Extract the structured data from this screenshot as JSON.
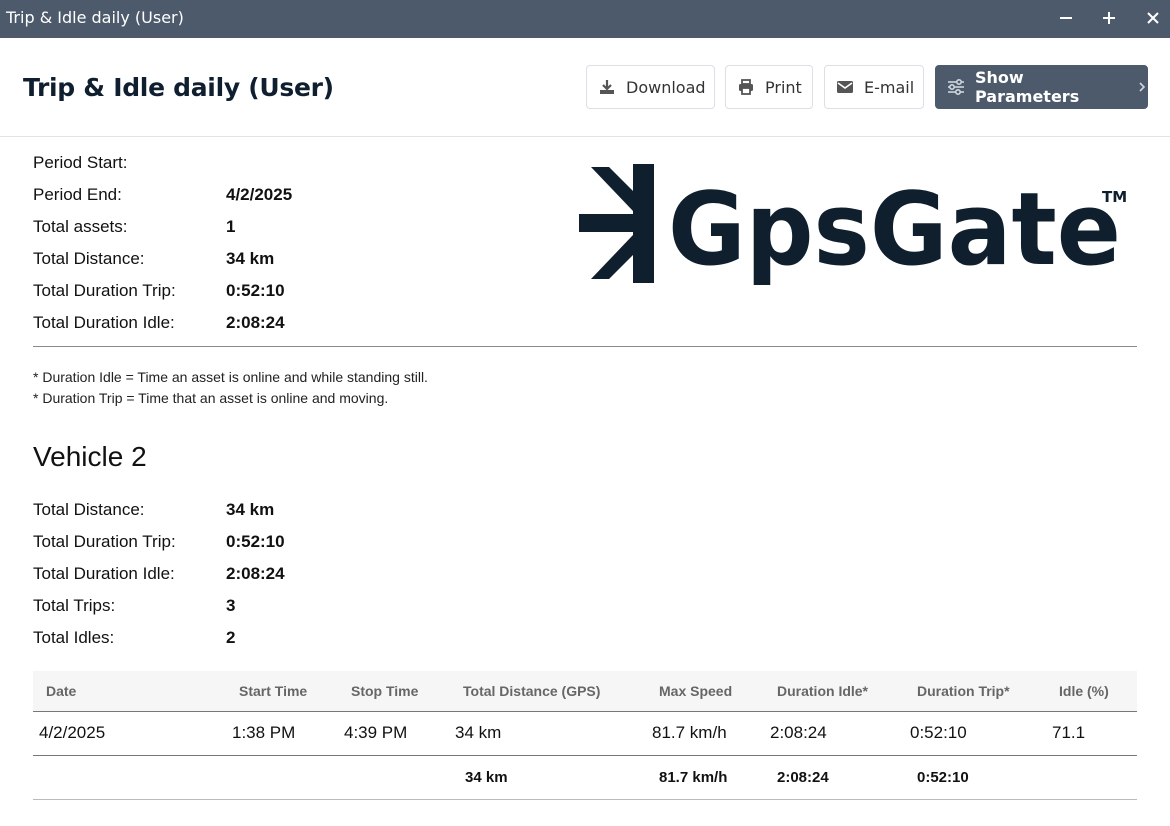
{
  "window": {
    "title": "Trip & Idle daily (User)",
    "controls": [
      "minimize",
      "maximize",
      "close"
    ]
  },
  "header": {
    "title": "Trip & Idle daily (User)",
    "buttons": {
      "download": "Download",
      "print": "Print",
      "email": "E-mail",
      "show_parameters": "Show Parameters"
    }
  },
  "colors": {
    "titlebar": "#4d5a6b",
    "primary_button": "#4d5a6b",
    "logo": "#0f1f2d"
  },
  "logo": {
    "text": "GpsGate",
    "tm": "TM"
  },
  "summary": [
    {
      "label": "Period Start:",
      "value": ""
    },
    {
      "label": "Period End:",
      "value": "4/2/2025"
    },
    {
      "label": "Total assets:",
      "value": "1"
    },
    {
      "label": "Total Distance:",
      "value": "34 km"
    },
    {
      "label": "Total Duration Trip:",
      "value": "0:52:10"
    },
    {
      "label": "Total Duration Idle:",
      "value": "2:08:24"
    }
  ],
  "notes": [
    "* Duration Idle = Time an asset is online and while standing still.",
    "* Duration Trip = Time that an asset is online and moving."
  ],
  "vehicle": {
    "name": "Vehicle 2",
    "stats": [
      {
        "label": "Total Distance:",
        "value": "34 km"
      },
      {
        "label": "Total Duration Trip:",
        "value": "0:52:10"
      },
      {
        "label": "Total Duration Idle:",
        "value": "2:08:24"
      },
      {
        "label": "Total Trips:",
        "value": "3"
      },
      {
        "label": "Total Idles:",
        "value": "2"
      }
    ],
    "table": {
      "columns": [
        "Date",
        "Start Time",
        "Stop Time",
        "Total Distance (GPS)",
        "Max Speed",
        "Duration Idle*",
        "Duration Trip*",
        "Idle (%)"
      ],
      "rows": [
        [
          "4/2/2025",
          "1:38 PM",
          "4:39 PM",
          "34 km",
          "81.7 km/h",
          "2:08:24",
          "0:52:10",
          "71.1"
        ]
      ],
      "totals": [
        "",
        "",
        "",
        "34 km",
        "81.7 km/h",
        "2:08:24",
        "0:52:10",
        ""
      ]
    }
  }
}
